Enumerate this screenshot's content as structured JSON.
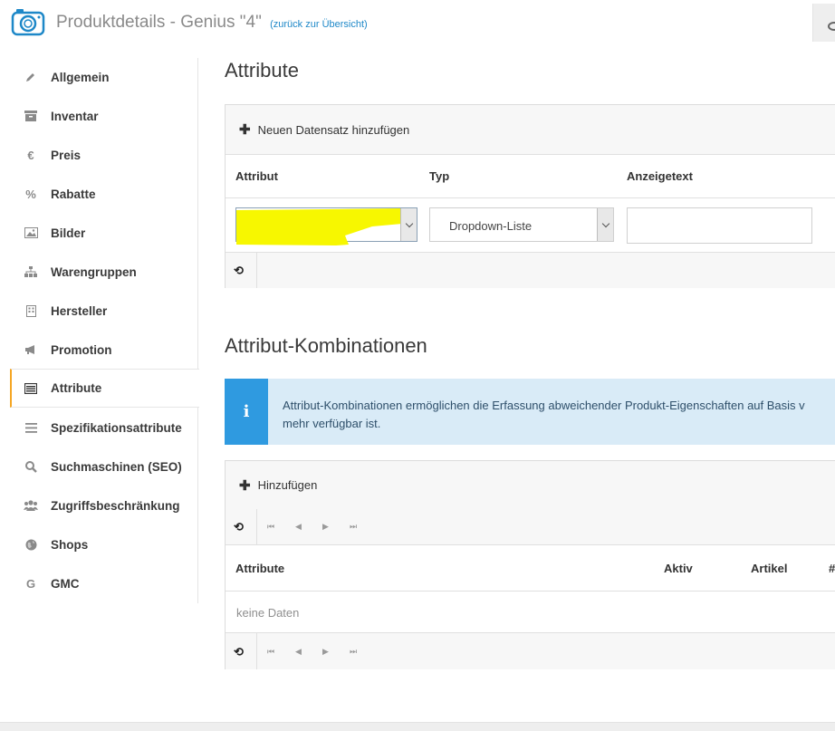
{
  "header": {
    "title": "Produktdetails - Genius \"4\"",
    "back_link": "(zurück zur Übersicht)"
  },
  "sidebar": {
    "items": [
      {
        "label": "Allgemein",
        "icon": "pencil-icon"
      },
      {
        "label": "Inventar",
        "icon": "archive-icon"
      },
      {
        "label": "Preis",
        "icon": "euro-icon"
      },
      {
        "label": "Rabatte",
        "icon": "percent-icon"
      },
      {
        "label": "Bilder",
        "icon": "image-icon"
      },
      {
        "label": "Warengruppen",
        "icon": "sitemap-icon"
      },
      {
        "label": "Hersteller",
        "icon": "building-icon"
      },
      {
        "label": "Promotion",
        "icon": "bullhorn-icon"
      },
      {
        "label": "Attribute",
        "icon": "list-alt-icon",
        "active": true
      },
      {
        "label": "Spezifikationsattribute",
        "icon": "bars-icon"
      },
      {
        "label": "Suchmaschinen (SEO)",
        "icon": "search-icon"
      },
      {
        "label": "Zugriffsbeschränkung",
        "icon": "users-icon"
      },
      {
        "label": "Shops",
        "icon": "globe-icon"
      },
      {
        "label": "GMC",
        "icon": "google-icon"
      }
    ]
  },
  "attributes": {
    "heading": "Attribute",
    "add_label": "Neuen Datensatz hinzufügen",
    "columns": {
      "attribut": "Attribut",
      "typ": "Typ",
      "anzeigetext": "Anzeigetext"
    },
    "row": {
      "typ_value": "Dropdown-Liste",
      "anzeigetext_value": ""
    },
    "highlight_color": "#f7f700"
  },
  "combinations": {
    "heading": "Attribut-Kombinationen",
    "info_line1": "Attribut-Kombinationen ermöglichen die Erfassung abweichender Produkt-Eigenschaften auf Basis v",
    "info_line2": "mehr verfügbar ist.",
    "add_label": "Hinzufügen",
    "columns": {
      "attribute": "Attribute",
      "aktiv": "Aktiv",
      "artikel": "Artikel",
      "hash": "#"
    },
    "empty_text": "keine Daten"
  },
  "icons": {
    "refresh": "refresh-icon",
    "first": "first-page-icon",
    "prev": "prev-page-icon",
    "next": "next-page-icon",
    "last": "last-page-icon"
  }
}
